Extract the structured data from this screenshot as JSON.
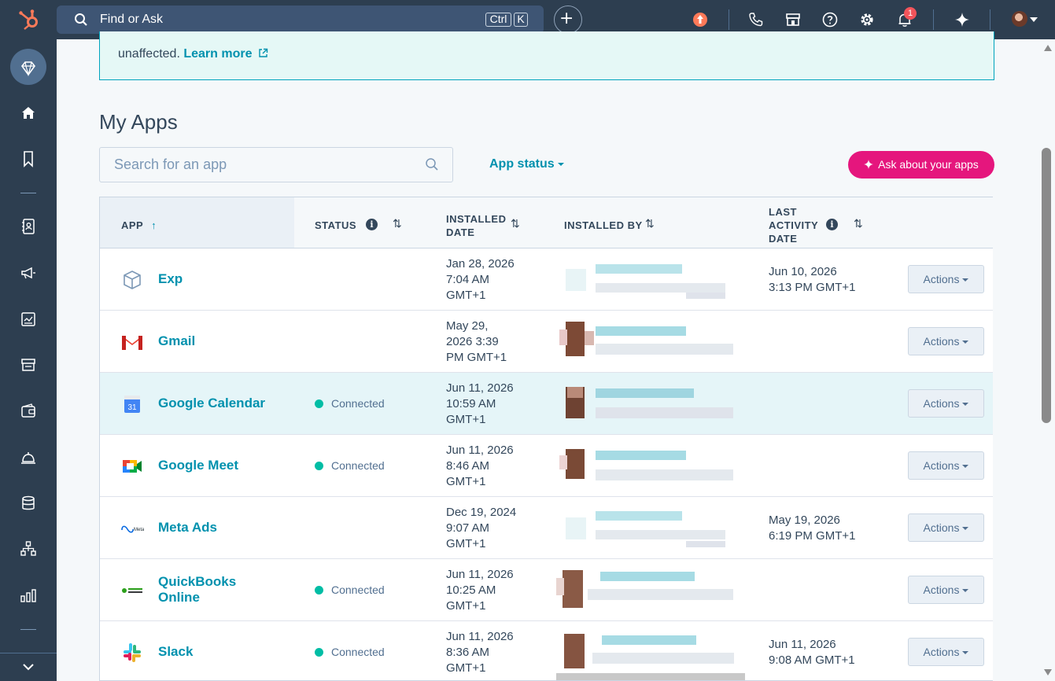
{
  "topbar": {
    "search_placeholder": "Find or Ask",
    "shortcut_ctrl": "Ctrl",
    "shortcut_k": "K",
    "notification_count": "1"
  },
  "banner": {
    "text": "unaffected.",
    "link": "Learn more"
  },
  "page": {
    "title": "My Apps",
    "search_placeholder": "Search for an app",
    "status_filter": "App status",
    "ask_button": "Ask about your apps"
  },
  "table": {
    "headers": {
      "app": "APP",
      "status": "STATUS",
      "installed_date_1": "INSTALLED",
      "installed_date_2": "DATE",
      "installed_by": "INSTALLED BY",
      "last_activity_1": "LAST",
      "last_activity_2": "ACTIVITY",
      "last_activity_3": "DATE"
    },
    "actions_label": "Actions",
    "rows": [
      {
        "name": "Exp",
        "status": "",
        "date": [
          "Jan 28, 2026",
          "7:04 AM",
          "GMT+1"
        ],
        "last": [
          "Jun 10, 2026",
          "3:13 PM GMT+1"
        ]
      },
      {
        "name": "Gmail",
        "status": "",
        "date": [
          "May 29,",
          "2026 3:39",
          "PM GMT+1"
        ],
        "last": [
          "",
          ""
        ]
      },
      {
        "name": "Google Calendar",
        "status": "Connected",
        "date": [
          "Jun 11, 2026",
          "10:59 AM",
          "GMT+1"
        ],
        "last": [
          "",
          ""
        ]
      },
      {
        "name": "Google Meet",
        "status": "Connected",
        "date": [
          "Jun 11, 2026",
          "8:46 AM",
          "GMT+1"
        ],
        "last": [
          "",
          ""
        ]
      },
      {
        "name": "Meta Ads",
        "status": "",
        "date": [
          "Dec 19, 2024",
          "9:07 AM",
          "GMT+1"
        ],
        "last": [
          "May 19, 2026",
          "6:19 PM GMT+1"
        ]
      },
      {
        "name_1": "QuickBooks",
        "name_2": "Online",
        "status": "Connected",
        "date": [
          "Jun 11, 2026",
          "10:25 AM",
          "GMT+1"
        ],
        "last": [
          "",
          ""
        ]
      },
      {
        "name": "Slack",
        "status": "Connected",
        "date": [
          "Jun 11, 2026",
          "8:36 AM",
          "GMT+1"
        ],
        "last": [
          "Jun 11, 2026",
          "9:08 AM GMT+1"
        ]
      }
    ]
  },
  "colors": {
    "nav_bg": "#2d3e50",
    "accent_teal": "#0091ae",
    "ask_button": "#e5167d",
    "connected": "#00bda5"
  }
}
